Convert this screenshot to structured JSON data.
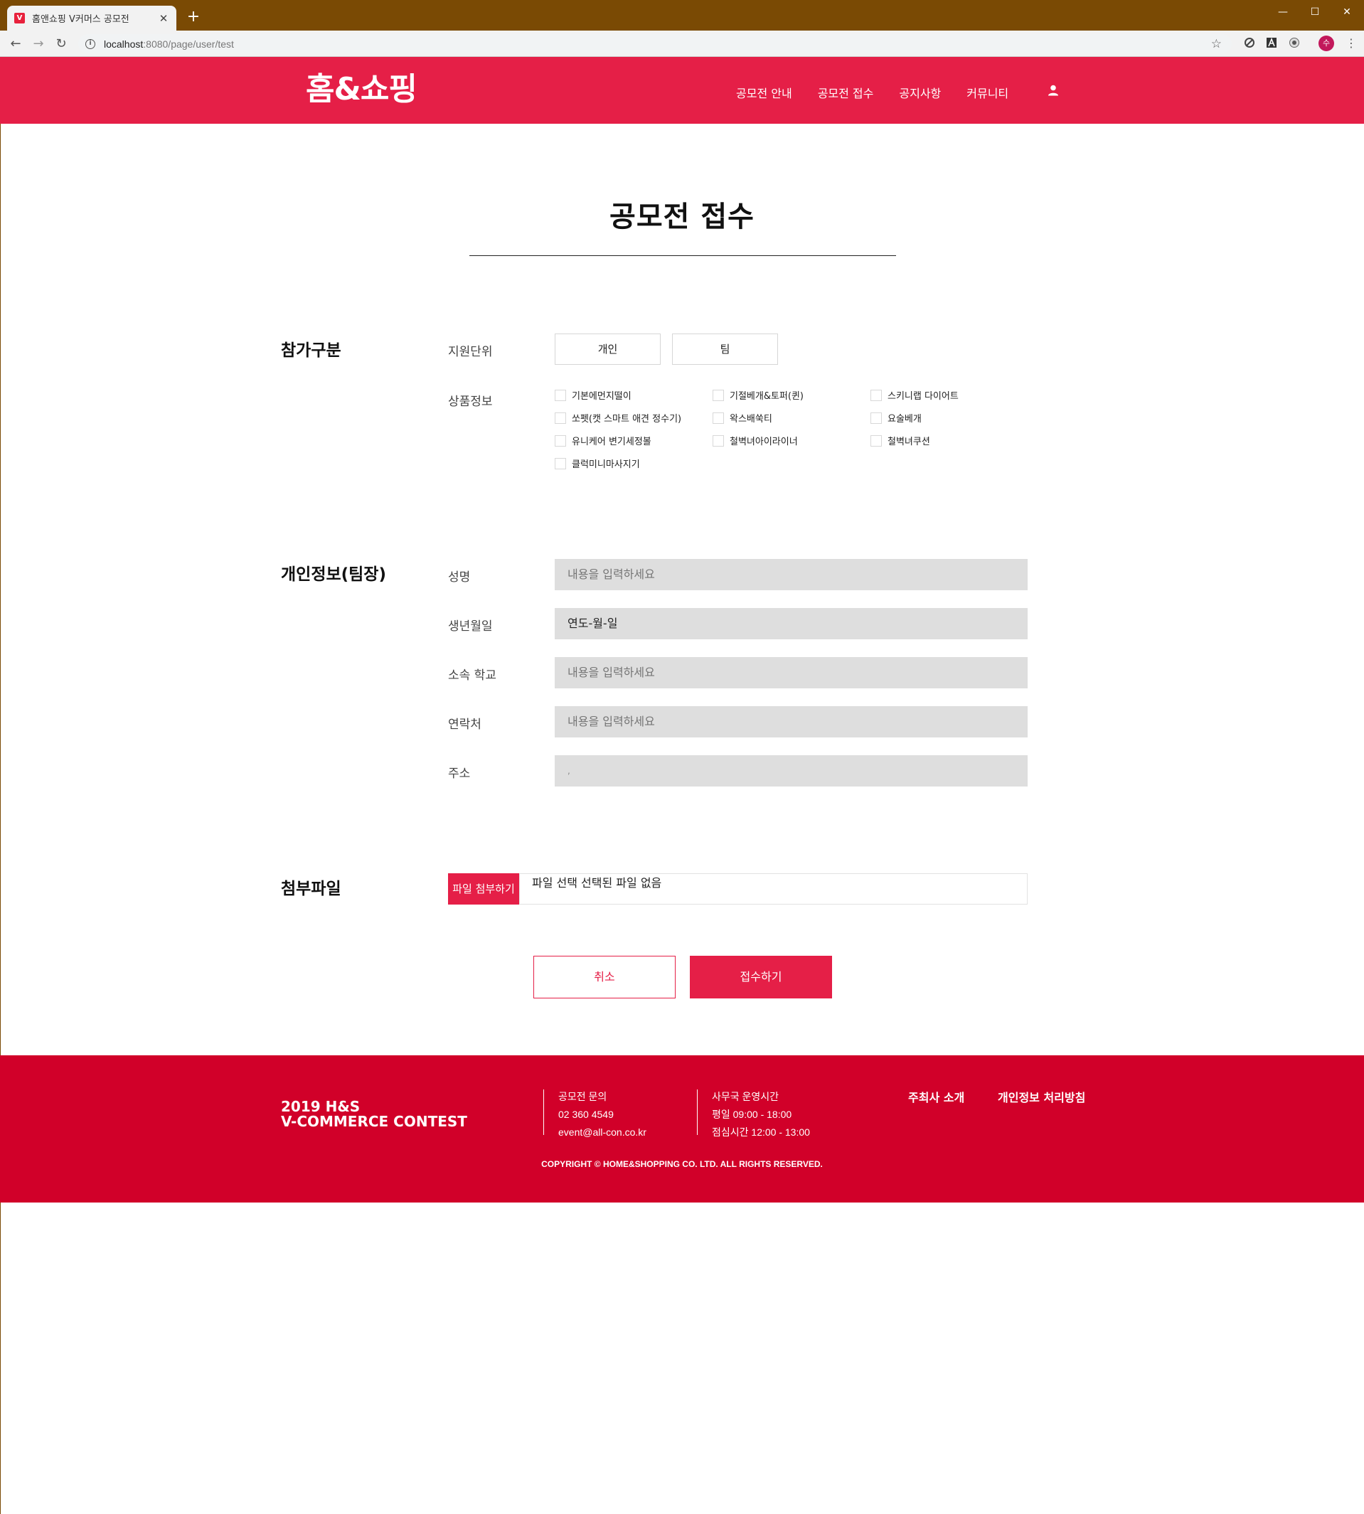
{
  "browser": {
    "tab_title": "홈앤쇼핑 V커머스 공모전",
    "tab_favicon": "V",
    "tab_close": "✕",
    "new_tab": "+",
    "window_controls": {
      "minimize": "—",
      "maximize": "☐",
      "close": "✕"
    },
    "nav": {
      "back": "←",
      "forward": "→",
      "reload": "↻"
    },
    "url_host": "localhost",
    "url_rest": ":8080/page/user/test",
    "star": "☆",
    "profile_initial": "수",
    "menu": "⋮"
  },
  "header": {
    "logo": "홈&쇼핑",
    "nav": [
      "공모전 안내",
      "공모전 접수",
      "공지사항",
      "커뮤니티"
    ],
    "user_icon": "user-icon"
  },
  "main": {
    "title": "공모전 접수",
    "participation": {
      "section_title": "참가구분",
      "unit_label": "지원단위",
      "unit_options": [
        "개인",
        "팀"
      ],
      "product_label": "상품정보",
      "products": [
        "기본에먼지떨이",
        "기절베개&토퍼(퀸)",
        "스키니랩 다이어트",
        "쏘펫(캣 스마트 애견 정수기)",
        "왁스배쑥티",
        "요술베개",
        "유니케어 변기세정볼",
        "철벽녀아이라이너",
        "철벽녀쿠션",
        "클럭미니마사지기"
      ]
    },
    "personal": {
      "section_title": "개인정보(팀장)",
      "fields": [
        {
          "label": "성명",
          "value": "",
          "placeholder": "내용을 입력하세요"
        },
        {
          "label": "생년월일",
          "value": "연도-월-일",
          "placeholder": ""
        },
        {
          "label": "소속 학교",
          "value": "",
          "placeholder": "내용을 입력하세요"
        },
        {
          "label": "연락처",
          "value": "",
          "placeholder": "내용을 입력하세요"
        },
        {
          "label": "주소",
          "value": ",",
          "placeholder": ""
        }
      ]
    },
    "attachment": {
      "section_title": "첨부파일",
      "button": "파일 첨부하기",
      "file_status": "파일 선택 선택된 파일 없음"
    },
    "actions": {
      "cancel": "취소",
      "submit": "접수하기"
    }
  },
  "footer": {
    "brand_line1": "2019 H&S",
    "brand_line2": "V-COMMERCE CONTEST",
    "contact": {
      "title": "공모전 문의",
      "phone": "02 360 4549",
      "email": "event@all-con.co.kr"
    },
    "hours": {
      "title": "사무국 운영시간",
      "weekday": "평일 09:00 - 18:00",
      "lunch": "점심시간 12:00 - 13:00"
    },
    "links": [
      "주최사 소개",
      "개인정보 처리방침"
    ],
    "copyright": "COPYRIGHT © HOME&SHOPPING CO. LTD. ALL RIGHTS RESERVED."
  },
  "colors": {
    "brand": "#e51f47",
    "footer": "#d10029",
    "titlebar": "#7a4a04",
    "input_bg": "#dedede"
  }
}
